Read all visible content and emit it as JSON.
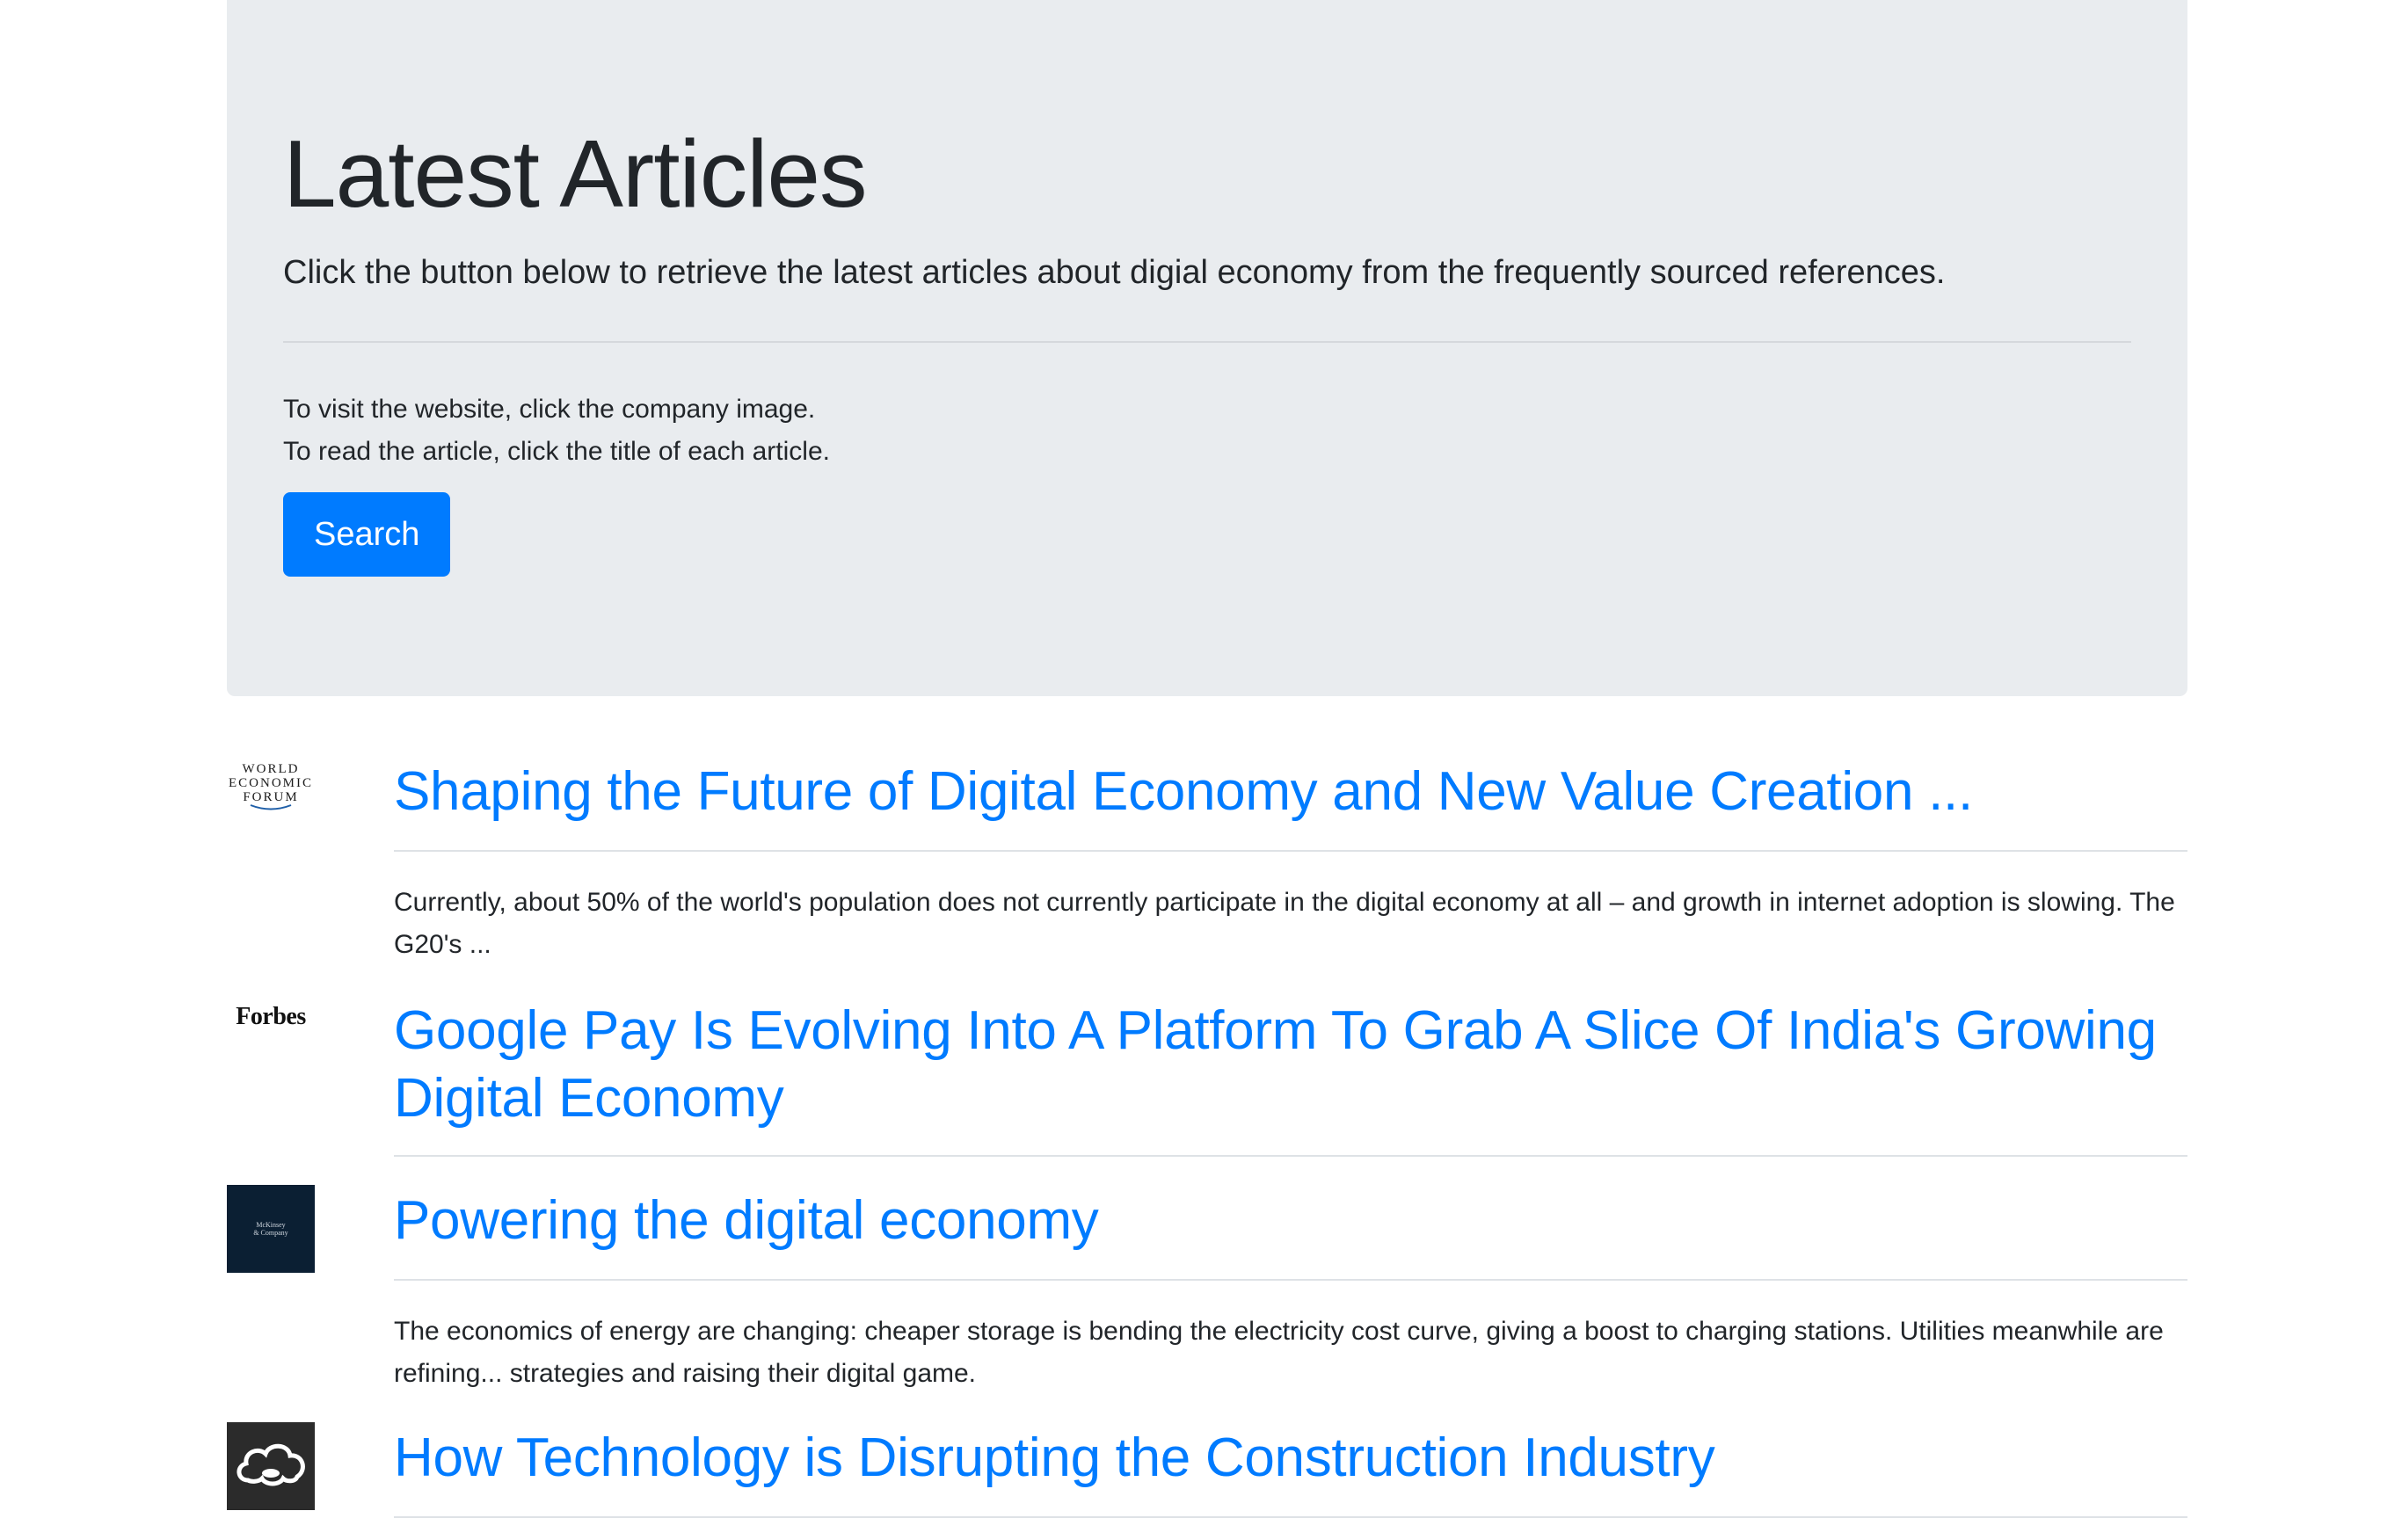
{
  "hero": {
    "title": "Latest Articles",
    "lead": "Click the button below to retrieve the latest articles about digial economy from the frequently sourced references.",
    "instruction_1": "To visit the website, click the company image.",
    "instruction_2": "To read the article, click the title of each article.",
    "search_label": "Search"
  },
  "articles": [
    {
      "source_icon": "world-economic-forum-logo",
      "logo_text": [
        "WORLD",
        "ECONOMIC",
        "FORUM"
      ],
      "title": "Shaping the Future of Digital Economy and New Value Creation ...",
      "description": "Currently, about 50% of the world's population does not currently participate in the digital economy at all – and growth in internet adoption is slowing. The G20's  ..."
    },
    {
      "source_icon": "forbes-logo",
      "logo_text": "Forbes",
      "title": "Google Pay Is Evolving Into A Platform To Grab A Slice Of India's Growing Digital Economy",
      "description": ""
    },
    {
      "source_icon": "mckinsey-logo",
      "logo_text": [
        "McKinsey",
        "& Company"
      ],
      "title": "Powering the digital economy",
      "description": "The economics of energy are changing: cheaper storage is bending the electricity cost curve, giving a boost to charging stations. Utilities meanwhile are refining... strategies and raising their digital game."
    },
    {
      "source_icon": "cloud-logo",
      "title": "How Technology is Disrupting the Construction Industry",
      "description": ""
    }
  ],
  "colors": {
    "jumbotron_bg": "#e9ecef",
    "primary": "#007bff",
    "text": "#212529"
  }
}
